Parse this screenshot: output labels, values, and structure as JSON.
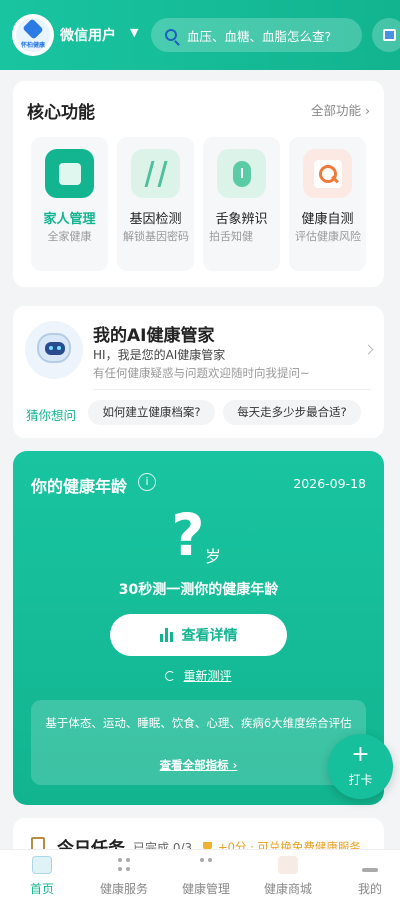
{
  "header": {
    "logo_text": "怀柏健康",
    "user_name": "微信用户",
    "search_placeholder": "血压、血糖、血脂怎么查?"
  },
  "core": {
    "title": "核心功能",
    "all_link": "全部功能 ›",
    "items": [
      {
        "label": "家人管理",
        "sub": "全家健康",
        "icon": "family-icon",
        "active": true
      },
      {
        "label": "基因检测",
        "sub": "解锁基因密码",
        "icon": "dna-icon"
      },
      {
        "label": "舌象辨识",
        "sub": "拍舌知健",
        "icon": "tongue-icon"
      },
      {
        "label": "健康自测",
        "sub": "评估健康风险",
        "icon": "self-test-icon"
      }
    ]
  },
  "ai": {
    "title": "我的AI健康管家",
    "greeting": "HI，我是您的AI健康管家",
    "desc": "有任何健康疑惑与问题欢迎随时向我提问~",
    "guess_label": "猜你想问",
    "chips": [
      "如何建立健康档案?",
      "每天走多少步最合适?"
    ]
  },
  "health_age": {
    "title": "你的健康年龄",
    "info": "i",
    "date": "2026-09-18",
    "value": "?",
    "unit": "岁",
    "prompt": "30秒测一测你的健康年龄",
    "detail_button": "查看详情",
    "retest": "重新测评",
    "note": "基于体态、运动、睡眠、饮食、心理、疾病6大维度综合评估",
    "all_indicators": "查看全部指标 ›"
  },
  "fab": {
    "plus": "+",
    "label": "打卡"
  },
  "tasks": {
    "title": "今日任务",
    "done": "已完成 0/3",
    "reward": "+0分 · 可兑换免费健康服务"
  },
  "nav": {
    "items": [
      {
        "label": "首页",
        "active": true
      },
      {
        "label": "健康服务"
      },
      {
        "label": "健康管理"
      },
      {
        "label": "健康商城"
      },
      {
        "label": "我的"
      }
    ]
  },
  "colors": {
    "accent": "#13b591",
    "header": "#19c4a0",
    "reward": "#e8a020"
  }
}
